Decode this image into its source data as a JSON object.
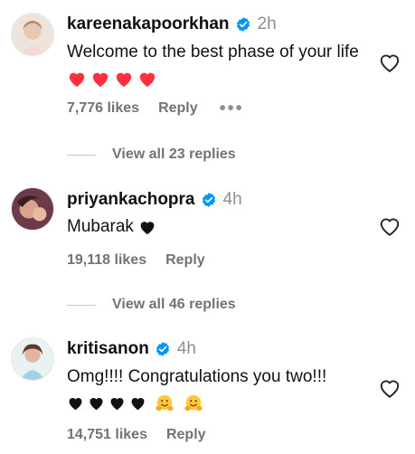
{
  "comments": [
    {
      "username": "kareenakapoorkhan",
      "time": "2h",
      "text": "Welcome to the best phase of your life",
      "emoji": "❤️❤️❤️❤️",
      "likes": "7,776 likes",
      "reply_label": "Reply",
      "more_label": "•••",
      "view_replies": "View all 23 replies"
    },
    {
      "username": "priyankachopra",
      "time": "4h",
      "text": "Mubarak",
      "emoji": "🖤",
      "likes": "19,118 likes",
      "reply_label": "Reply",
      "view_replies": "View all 46 replies"
    },
    {
      "username": "kritisanon",
      "time": "4h",
      "text": "Omg!!!! Congratulations you two!!!",
      "emoji": "🖤🖤🖤🖤 🤗 🤗",
      "likes": "14,751 likes",
      "reply_label": "Reply"
    }
  ],
  "colors": {
    "verified": "#0095f6",
    "heart_red": "#ff3040",
    "secondary_text": "#737373"
  },
  "icons": {
    "verified": "verified-badge-icon",
    "like": "heart-outline-icon",
    "more": "more-horizontal-icon"
  }
}
